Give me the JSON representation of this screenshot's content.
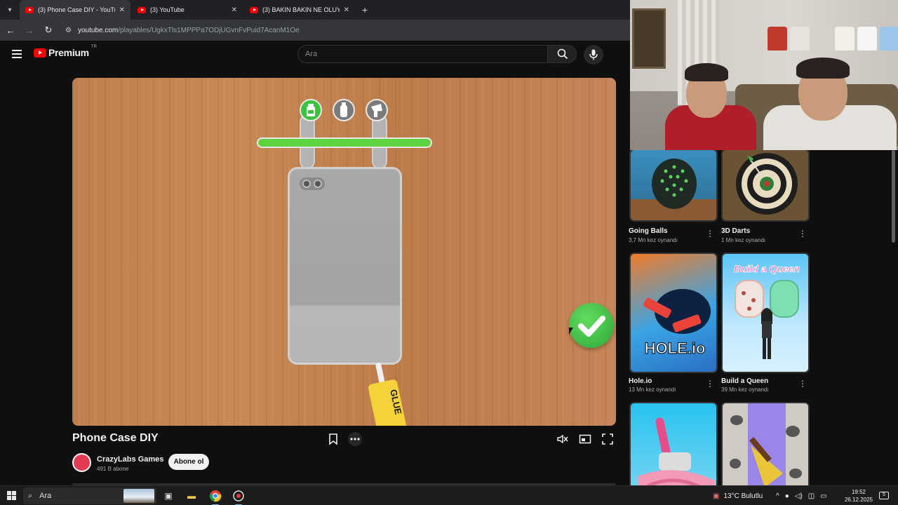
{
  "browser": {
    "tabs": [
      {
        "title": "(3) Phone Case DIY - YouTube",
        "active": true
      },
      {
        "title": "(3) YouTube",
        "active": false
      },
      {
        "title": "(3) BAKIN BAKIN NE OLUYOR? |",
        "active": false
      }
    ],
    "new_tab_symbol": "+",
    "url_host": "youtube.com",
    "url_path": "/playables/UgkxTls1MPPPa7ODjUGvnFvPuid7AcanM1Oe"
  },
  "youtube": {
    "brand": "Premium",
    "region": "TR",
    "search_placeholder": "Ara"
  },
  "game": {
    "title": "Phone Case DIY",
    "progress": 1.0,
    "tube_label": "GLUE",
    "accent_green": "#5ed23f",
    "tools": [
      "glue-bottle-icon",
      "spray-can-icon",
      "hair-dryer-icon"
    ]
  },
  "channel": {
    "name": "CrazyLabs Games",
    "subscribers": "491 B abone",
    "subscribe_label": "Abone ol"
  },
  "sidebar": {
    "cards": [
      {
        "title": "Going Balls",
        "plays": "3,7 Mn kez oynandı"
      },
      {
        "title": "3D Darts",
        "plays": "1 Mn kez oynandı"
      },
      {
        "title": "Hole.io",
        "plays": "13 Mn kez oynandı"
      },
      {
        "title": "Build a Queen",
        "plays": "39 Mn kez oynandı"
      },
      {
        "title": "",
        "plays": ""
      },
      {
        "title": "",
        "plays": ""
      }
    ],
    "thumb_text": {
      "hole": "HOLE.io",
      "queen": "Build a Queen"
    }
  },
  "taskbar": {
    "search_label": "Ara",
    "weather": "13°C  Bulutlu",
    "time": "19:52",
    "date": "26.12.2025",
    "notifications": "5"
  }
}
